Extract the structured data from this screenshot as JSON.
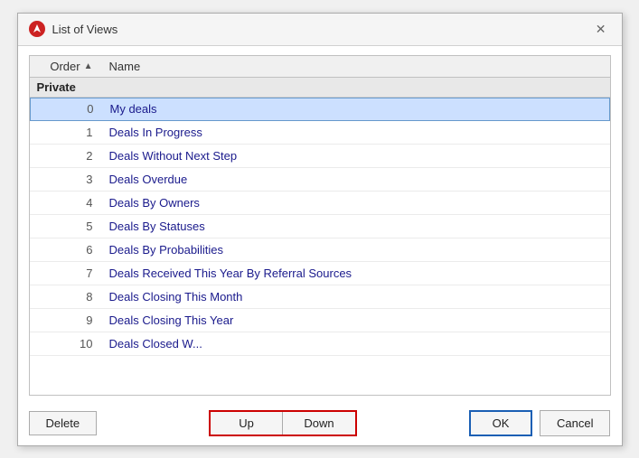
{
  "dialog": {
    "title": "List of Views",
    "close_label": "✕"
  },
  "table": {
    "col_order": "Order",
    "col_name": "Name",
    "sort_arrow": "▲"
  },
  "sections": [
    {
      "label": "Private",
      "rows": [
        {
          "order": "0",
          "name": "My deals",
          "selected": true
        },
        {
          "order": "1",
          "name": "Deals In Progress",
          "selected": false
        },
        {
          "order": "2",
          "name": "Deals Without Next Step",
          "selected": false
        },
        {
          "order": "3",
          "name": "Deals Overdue",
          "selected": false
        },
        {
          "order": "4",
          "name": "Deals By Owners",
          "selected": false
        },
        {
          "order": "5",
          "name": "Deals By Statuses",
          "selected": false
        },
        {
          "order": "6",
          "name": "Deals By Probabilities",
          "selected": false
        },
        {
          "order": "7",
          "name": "Deals Received This Year By Referral Sources",
          "selected": false
        },
        {
          "order": "8",
          "name": "Deals Closing This Month",
          "selected": false
        },
        {
          "order": "9",
          "name": "Deals Closing This Year",
          "selected": false
        },
        {
          "order": "10",
          "name": "Deals Closed W...",
          "selected": false
        }
      ]
    }
  ],
  "buttons": {
    "delete": "Delete",
    "up": "Up",
    "down": "Down",
    "ok": "OK",
    "cancel": "Cancel"
  }
}
